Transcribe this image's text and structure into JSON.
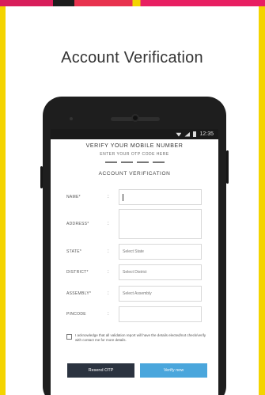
{
  "page": {
    "heading": "Account Verification"
  },
  "phone": {
    "status_time": "12:35",
    "verify_title": "VERIFY YOUR MOBILE NUMBER",
    "otp_hint": "ENTER YOUR OTP CODE HERE",
    "section_title": "ACCOUNT VERIFICATION",
    "fields": [
      {
        "label": "NAME*",
        "placeholder": ""
      },
      {
        "label": "ADDRESS*",
        "placeholder": ""
      },
      {
        "label": "STATE*",
        "placeholder": "Select State"
      },
      {
        "label": "DISTRICT*",
        "placeholder": "Select District"
      },
      {
        "label": "ASSEMBLY*",
        "placeholder": "Select Assembly"
      },
      {
        "label": "PINCODE",
        "placeholder": ""
      }
    ],
    "consent_text": "I acknowledge that all validation report will have the details elected/not check/verify with contact me for more details.",
    "resend_label": "Resend OTP",
    "verify_label": "Verify now"
  },
  "colors": {
    "frame": "#f4d400",
    "resend_button": "#2b3340",
    "verify_button": "#4aa6dc"
  }
}
